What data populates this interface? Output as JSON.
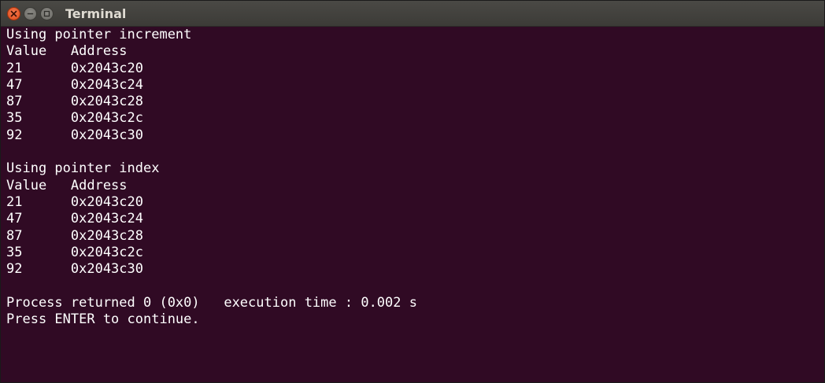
{
  "window": {
    "title": "Terminal"
  },
  "terminal": {
    "lines": [
      "Using pointer increment",
      "Value   Address",
      "21      0x2043c20",
      "47      0x2043c24",
      "87      0x2043c28",
      "35      0x2043c2c",
      "92      0x2043c30",
      "",
      "Using pointer index",
      "Value   Address",
      "21      0x2043c20",
      "47      0x2043c24",
      "87      0x2043c28",
      "35      0x2043c2c",
      "92      0x2043c30",
      "",
      "Process returned 0 (0x0)   execution time : 0.002 s",
      "Press ENTER to continue."
    ]
  },
  "colors": {
    "terminal_background": "#300a24",
    "terminal_text": "#ffffff",
    "titlebar": "#3c3b37",
    "close_button": "#df4a16"
  },
  "icons": {
    "close": "close-icon",
    "minimize": "minimize-icon",
    "maximize": "maximize-icon"
  }
}
